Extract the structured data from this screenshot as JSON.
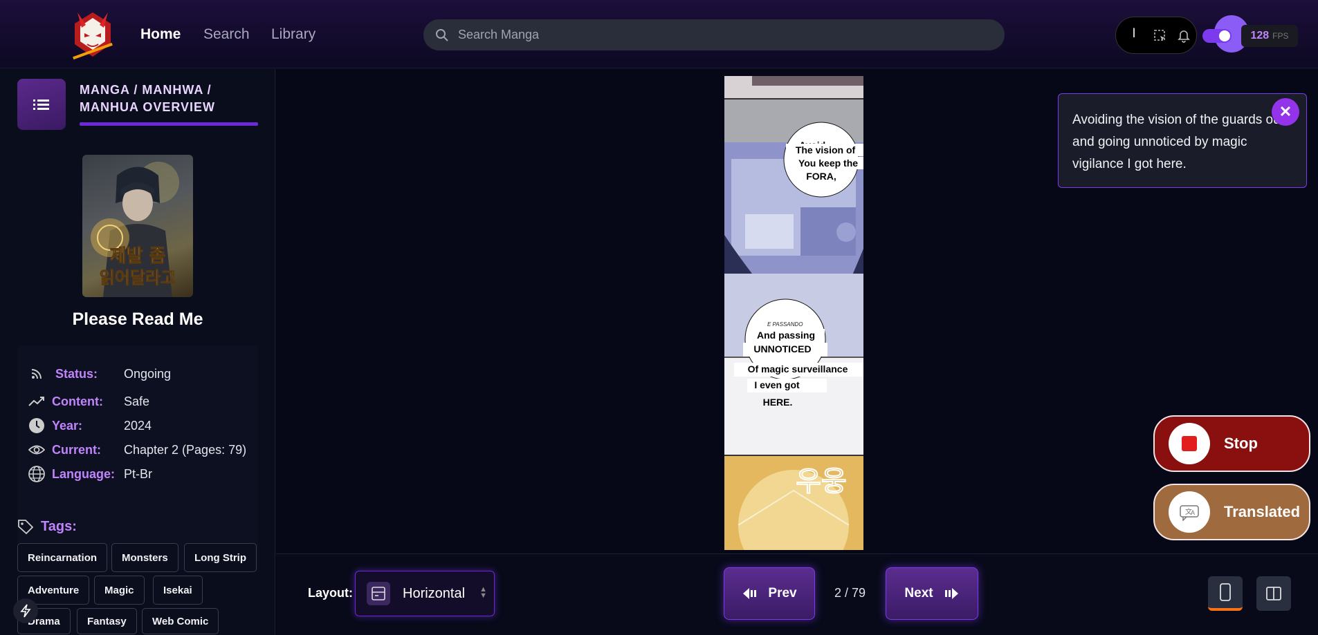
{
  "nav": {
    "home": "Home",
    "search": "Search",
    "library": "Library"
  },
  "search": {
    "placeholder": "Search Manga"
  },
  "translator": {
    "current_lang": "l"
  },
  "fps": {
    "value": "128",
    "unit": "FPS"
  },
  "sidebar": {
    "overview_title": "MANGA / MANHWA / MANHUA OVERVIEW",
    "cover_text": "제발 좀 읽어달라고",
    "manga_title": "Please Read Me",
    "info": [
      {
        "key": "Status:",
        "value": "Ongoing",
        "icon": "rss-icon"
      },
      {
        "key": "Content:",
        "value": "Safe",
        "icon": "trend-icon"
      },
      {
        "key": "Year:",
        "value": "2024",
        "icon": "clock-icon"
      },
      {
        "key": "Current:",
        "value": "Chapter 2 (Pages: 79)",
        "icon": "eye-icon"
      },
      {
        "key": "Language:",
        "value": "Pt-Br",
        "icon": "globe-icon"
      }
    ],
    "tags_label": "Tags:",
    "tags": [
      "Reincarnation",
      "Monsters",
      "Long Strip",
      "Adventure",
      "Magic",
      "Isekai",
      "Drama",
      "Fantasy",
      "Web Comic"
    ]
  },
  "page": {
    "bubble1": [
      "Avoid",
      "The vision of",
      "You keep the",
      "FORA,"
    ],
    "bubble2": [
      "E PASSANDO",
      "And passing",
      "UNNOTICED"
    ],
    "caption": [
      "Of magic surveillance",
      "I even got",
      "HERE."
    ],
    "sfx": "우웅"
  },
  "tooltip": {
    "text": "Avoiding the vision of the guards out, and going unnoticed by magic vigilance I got here."
  },
  "fab": {
    "stop": "Stop",
    "translated": "Translated"
  },
  "bottom": {
    "layout_label": "Layout:",
    "layout_value": "Horizontal",
    "prev": "Prev",
    "next": "Next",
    "page_count": "2 / 79"
  }
}
